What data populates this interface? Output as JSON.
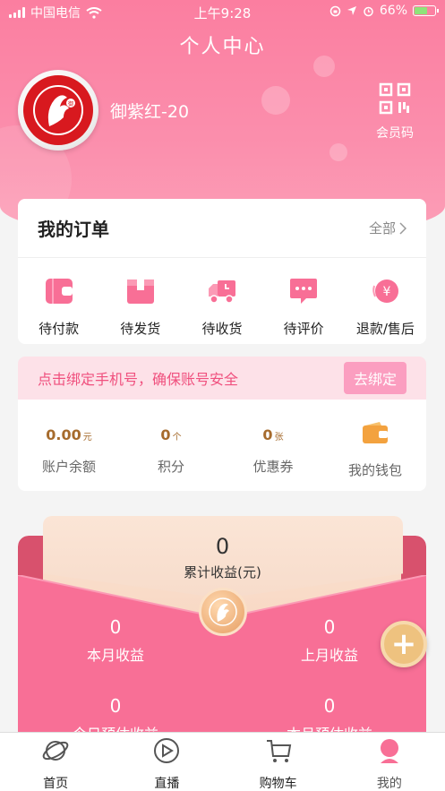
{
  "status_bar": {
    "carrier": "中国电信",
    "time": "上午9:28",
    "battery": "66%"
  },
  "header": {
    "title": "个人中心",
    "username": "御紫红-20",
    "member_code_label": "会员码"
  },
  "orders": {
    "title": "我的订单",
    "all_label": "全部",
    "items": [
      {
        "label": "待付款",
        "icon": "wallet-card-icon"
      },
      {
        "label": "待发货",
        "icon": "box-icon"
      },
      {
        "label": "待收货",
        "icon": "truck-icon"
      },
      {
        "label": "待评价",
        "icon": "chat-bubble-icon"
      },
      {
        "label": "退款/售后",
        "icon": "yen-refund-icon"
      }
    ]
  },
  "bind_phone": {
    "text": "点击绑定手机号，确保账号安全",
    "button": "去绑定"
  },
  "stats": [
    {
      "value": "0.00",
      "unit": "元",
      "label": "账户余额"
    },
    {
      "value": "0",
      "unit": "个",
      "label": "积分"
    },
    {
      "value": "0",
      "unit": "张",
      "label": "优惠券"
    },
    {
      "label": "我的钱包",
      "icon": "wallet-icon"
    }
  ],
  "earnings": {
    "total_value": "0",
    "total_label": "累计收益(元)",
    "items": [
      {
        "value": "0",
        "label": "本月收益"
      },
      {
        "value": "0",
        "label": "上月收益"
      },
      {
        "value": "0",
        "label": "今日预估收益"
      },
      {
        "value": "0",
        "label": "本月预估收益"
      }
    ]
  },
  "tabs": [
    {
      "label": "首页",
      "icon": "planet-icon"
    },
    {
      "label": "直播",
      "icon": "play-circle-icon"
    },
    {
      "label": "购物车",
      "icon": "cart-icon"
    },
    {
      "label": "我的",
      "icon": "user-icon"
    }
  ],
  "colors": {
    "brand_pink": "#fb7ea0",
    "accent_gold": "#a66b2d"
  }
}
